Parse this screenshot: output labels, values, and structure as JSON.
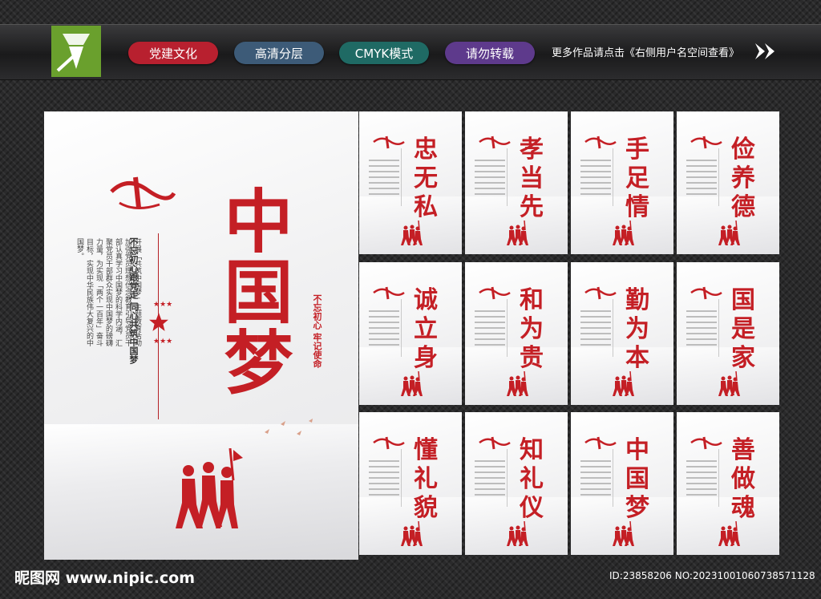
{
  "header": {
    "tags": [
      "党建文化",
      "高清分层",
      "CMYK模式",
      "请勿转载"
    ],
    "hint": "更多作品请点击《右侧用户名空间查看》",
    "colors": {
      "tag1": "#b8202f",
      "tag2": "#3d5b78",
      "tag3": "#1f6a64",
      "tag4": "#5e3a8c",
      "logo": "#6aa02d"
    }
  },
  "main_poster": {
    "title": "中国梦",
    "slogan": "不忘初心跟党走 同心共筑中国梦",
    "body": "开展「共筑中国梦」主题教育活动加强党员理想信念教育引导党员干部认真学习中国梦的科学内涵，汇聚党员干部群众实现中国梦的磅礴力量，为实现「两个一百年」奋斗目标，实现中华民族伟大复兴的中国梦。",
    "tag": "不忘初心 牢记使命",
    "accent": "#c41f25"
  },
  "cards": [
    {
      "title": "忠无私"
    },
    {
      "title": "孝当先"
    },
    {
      "title": "手足情"
    },
    {
      "title": "俭养德"
    },
    {
      "title": "诚立身"
    },
    {
      "title": "和为贵"
    },
    {
      "title": "勤为本"
    },
    {
      "title": "国是家"
    },
    {
      "title": "懂礼貌"
    },
    {
      "title": "知礼仪"
    },
    {
      "title": "中国梦"
    },
    {
      "title": "善做魂"
    }
  ],
  "footer": {
    "site": "昵图网 www.nipic.com",
    "id": "ID:23858206 NO:20231001060738571128"
  }
}
